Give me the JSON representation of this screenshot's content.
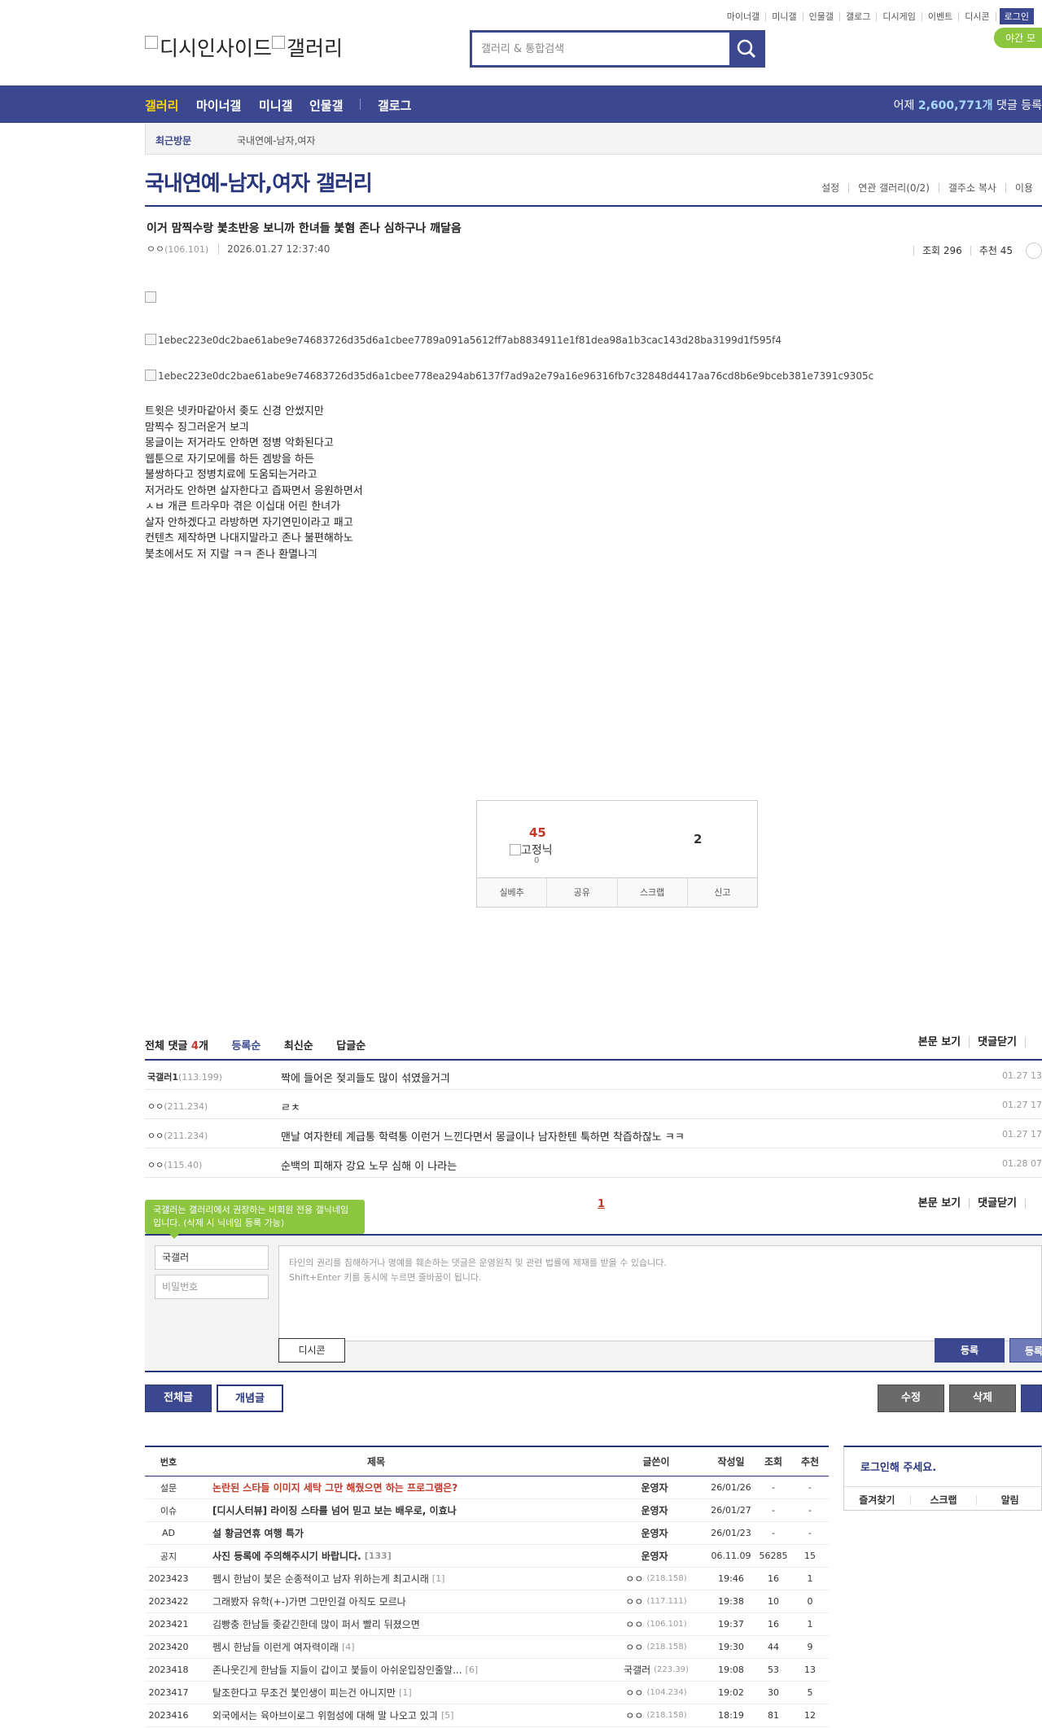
{
  "util": {
    "links": [
      "마이너갤",
      "미니갤",
      "인물갤",
      "갤로그",
      "디시게임",
      "이벤트",
      "디시콘"
    ],
    "login": "로그인",
    "night": "야간 모"
  },
  "logo": {
    "alt1": "디시인사이드",
    "alt2": "갤러리"
  },
  "search": {
    "placeholder": "갤러리 & 통합검색"
  },
  "gnb": {
    "items": [
      "갤러리",
      "마이너갤",
      "미니갤",
      "인물갤",
      "갤로그"
    ],
    "count_prefix": "어제 ",
    "count": "2,600,771개",
    "count_suffix": " 댓글 등록"
  },
  "visit": {
    "label": "최근방문",
    "item": "국내연예-남자,여자"
  },
  "gallery": {
    "title": "국내연예-남자,여자 갤러리",
    "tools": [
      "설정",
      "연관 갤러리(0/2)",
      "갤주소 복사",
      "이용"
    ]
  },
  "post": {
    "title": "이거 맘찍수랑 붗초반응 보니까 한녀들 붗혐 존나 심하구나 깨달음",
    "author": "ㅇㅇ",
    "ip": "(106.101)",
    "date": "2026.01.27 12:37:40",
    "views": "조회 296",
    "recommend": "추천 45",
    "images": [
      "",
      "1ebec223e0dc2bae61abe9e74683726d35d6a1cbee7789a091a5612ff7ab8834911e1f81dea98a1b3cac143d28ba3199d1f595f4",
      "1ebec223e0dc2bae61abe9e74683726d35d6a1cbee778ea294ab6137f7ad9a2e79a16e96316fb7c32848d4417aa76cd8b6e9bceb381e7391c9305c"
    ],
    "body": [
      "트윗은 넷카마같아서 좆도 신경 안썼지만",
      "맘찍수 징그러운거 보긔",
      "몽글이는 저거라도 안하면 정병 악화된다고",
      "웹툰으로 자기모에를 하든 겜방을 하든",
      "불쌍하다고 정병치료에 도움되는거라고",
      "저거라도 안하면 살자한다고 즙짜면서 응원하면서",
      "ㅅㅂ 개큰 트라우마 겪은 이십대 어린 한녀가",
      "살자 안하겠다고 라방하면 자기연민이라고 패고",
      "컨텐츠 제작하면 나대지말라고 존나 불편해하노",
      "붗초에서도 저 지랄 ㅋㅋ 존나 환멸나긔"
    ]
  },
  "rec": {
    "up": "45",
    "fix_alt": "고정닉",
    "fix_count": "0",
    "down": "2",
    "buttons": [
      "실베추",
      "공유",
      "스크랩",
      "신고"
    ]
  },
  "comments": {
    "total_prefix": "전체 댓글 ",
    "total": "4",
    "total_suffix": "개",
    "sorts": [
      "등록순",
      "최신순",
      "답글순"
    ],
    "right": [
      "본문 보기",
      "댓글닫기"
    ],
    "rows": [
      {
        "nick": "국갤러1",
        "ip": "(113.199)",
        "text": "짝에 들어온 젖괴들도 많이 섞였을거긔",
        "date": "01.27 13"
      },
      {
        "nick": "ㅇㅇ",
        "ip": "(211.234)",
        "text": "ㄹㅊ",
        "date": "01.27 17"
      },
      {
        "nick": "ㅇㅇ",
        "ip": "(211.234)",
        "text": "맨날 여자한테 계급통 학력통 이런거 느낀다면서 몽글이나 남자한텐 툭하면 착즙하잖노 ㅋㅋ",
        "date": "01.27 17"
      },
      {
        "nick": "ㅇㅇ",
        "ip": "(115.40)",
        "text": "순백의 피해자 강요 노무 심해 이 나라는",
        "date": "01.28 07"
      }
    ],
    "page": "1",
    "tip": "국갤러는 갤러리에서 권장하는 비회원 전용 갤닉네임입니다. (삭제 시 닉네임 등록 가능)",
    "nick_value": "국갤러",
    "pw_placeholder": "비밀번호",
    "textarea_line1": "타인의 권리를 침해하거나 명예를 훼손하는 댓글은 운영원칙 및 관련 법률에 제재를 받을 수 있습니다.",
    "textarea_line2": "Shift+Enter 키를 동시에 누르면 줄바꿈이 됩니다.",
    "dccon": "디시콘",
    "submit": "등록",
    "submit2": "등록"
  },
  "buttons": {
    "all": "전체글",
    "best": "개념글",
    "edit": "수정",
    "delete": "삭제"
  },
  "list": {
    "headers": [
      "번호",
      "제목",
      "글쓴이",
      "작성일",
      "조회",
      "추천"
    ],
    "rows": [
      {
        "no": "설문",
        "title": "논란된 스타들 이미지 세탁 그만 해줬으면 하는 프로그램은?",
        "style": "red",
        "cmt": "",
        "writer": "운영자",
        "ip": "",
        "date": "26/01/26",
        "views": "-",
        "rec": "-"
      },
      {
        "no": "이슈",
        "title": "[디시人터뷰] 라이징 스타를 넘어 믿고 보는 배우로, 이효나",
        "style": "bold",
        "cmt": "",
        "writer": "운영자",
        "ip": "",
        "date": "26/01/27",
        "views": "-",
        "rec": "-"
      },
      {
        "no": "AD",
        "title": "설 황금연휴 여행 특가",
        "style": "bold",
        "cmt": "",
        "writer": "운영자",
        "ip": "",
        "date": "26/01/23",
        "views": "-",
        "rec": "-"
      },
      {
        "no": "공지",
        "title": "사진 등록에 주의해주시기 바랍니다.",
        "style": "bold",
        "cmt": "[133]",
        "writer": "운영자",
        "ip": "",
        "date": "06.11.09",
        "views": "56285",
        "rec": "15"
      },
      {
        "no": "2023423",
        "title": "펨시 한남이 붗은 순종적이고 남자 위하는게 최고시래",
        "style": "",
        "cmt": "[1]",
        "writer": "ㅇㅇ",
        "ip": "(218.158)",
        "date": "19:46",
        "views": "16",
        "rec": "1"
      },
      {
        "no": "2023422",
        "title": "그래봤자 유학(+-)가면 그만인걸 아직도 모르나",
        "style": "",
        "cmt": "",
        "writer": "ㅇㅇ",
        "ip": "(117.111)",
        "date": "19:38",
        "views": "10",
        "rec": "0"
      },
      {
        "no": "2023421",
        "title": "김빵충 한남들 좆같긴한데 많이 퍼서 빨리 뒤졌으면",
        "style": "",
        "cmt": "",
        "writer": "ㅇㅇ",
        "ip": "(106.101)",
        "date": "19:37",
        "views": "16",
        "rec": "1"
      },
      {
        "no": "2023420",
        "title": "펨시 한남들 이런게 여자력이래",
        "style": "",
        "cmt": "[4]",
        "writer": "ㅇㅇ",
        "ip": "(218.158)",
        "date": "19:30",
        "views": "44",
        "rec": "9"
      },
      {
        "no": "2023418",
        "title": "존나웃긴게 한남들 지들이 갑이고 붗들이 아쉬운입장인줄알...",
        "style": "",
        "cmt": "[6]",
        "writer": "국갤러",
        "ip": "(223.39)",
        "date": "19:08",
        "views": "53",
        "rec": "13"
      },
      {
        "no": "2023417",
        "title": "탈조한다고 무조건 붗인생이 피는건 아니지만",
        "style": "",
        "cmt": "[1]",
        "writer": "ㅇㅇ",
        "ip": "(104.234)",
        "date": "19:02",
        "views": "30",
        "rec": "5"
      },
      {
        "no": "2023416",
        "title": "외국에서는 육아브이로그 위험성에 대해 말 나오고 있긔",
        "style": "",
        "cmt": "[5]",
        "writer": "ㅇㅇ",
        "ip": "(218.158)",
        "date": "18:19",
        "views": "81",
        "rec": "12"
      }
    ]
  },
  "loginbox": {
    "title": "로그인해 주세요.",
    "items": [
      "즐겨찾기",
      "스크랩",
      "알림"
    ]
  }
}
